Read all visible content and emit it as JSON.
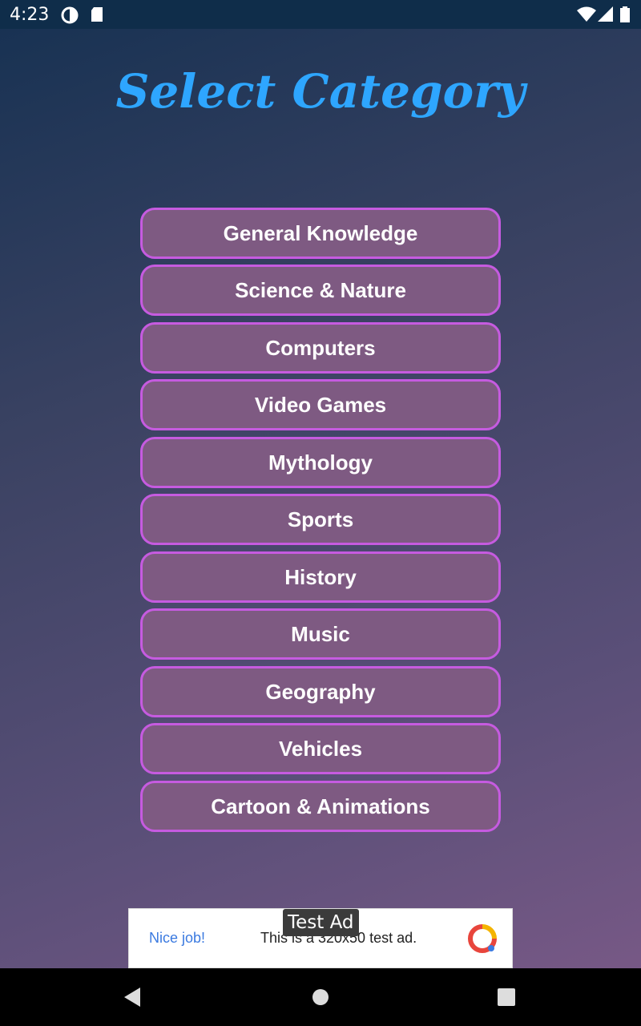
{
  "status": {
    "time": "4:23"
  },
  "screen": {
    "title": "Select Category"
  },
  "categories": [
    "General Knowledge",
    "Science & Nature",
    "Computers",
    "Video Games",
    "Mythology",
    "Sports",
    "History",
    "Music",
    "Geography",
    "Vehicles",
    "Cartoon & Animations"
  ],
  "ad": {
    "tag": "Test Ad",
    "headline": "Nice job!",
    "message": "This is a 320x50 test ad."
  },
  "colors": {
    "title": "#2ea6ff",
    "button_border": "#c65be0",
    "button_fill": "#7e5a82"
  }
}
